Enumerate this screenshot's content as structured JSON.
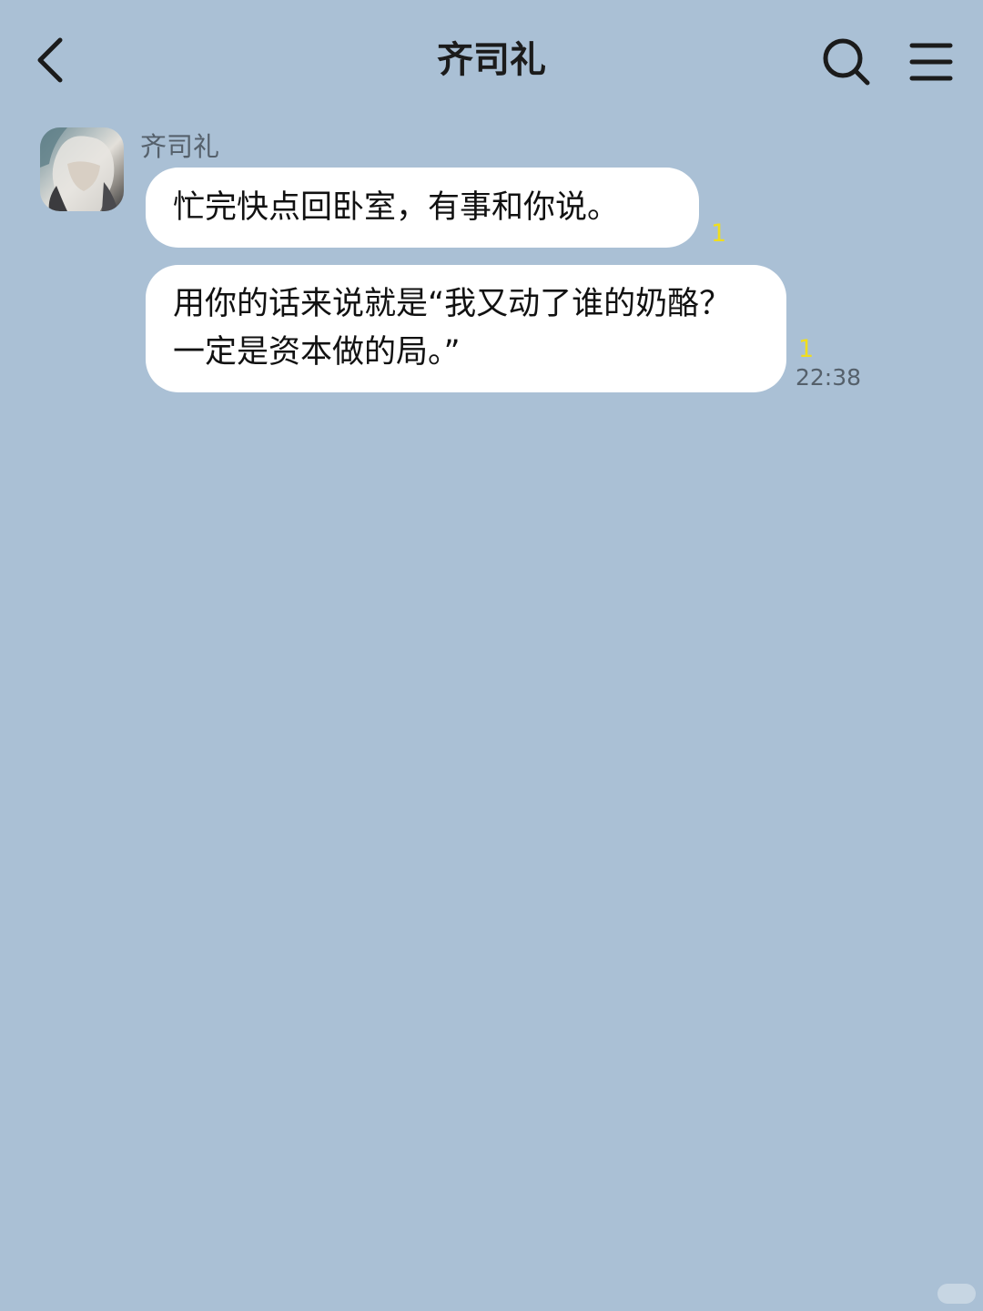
{
  "header": {
    "title": "齐司礼",
    "back_icon": "chevron-left-icon",
    "search_icon": "search-icon",
    "menu_icon": "menu-icon"
  },
  "chat": {
    "sender_name": "齐司礼",
    "messages": [
      {
        "text": "忙完快点回卧室，有事和你说。",
        "unread": "1"
      },
      {
        "text": "用你的话来说就是“我又动了谁的奶酪？一定是资本做的局。”",
        "unread": "1",
        "time": "22:38"
      }
    ]
  },
  "colors": {
    "background": "#aac0d5",
    "bubble": "#ffffff",
    "unread": "#f0de1e",
    "meta_text": "#55606b"
  }
}
